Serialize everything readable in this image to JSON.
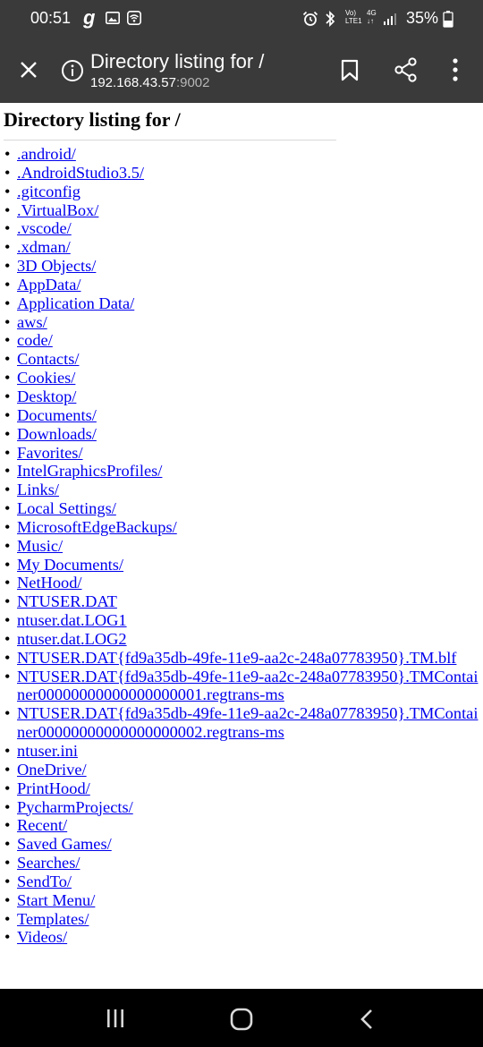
{
  "status_bar": {
    "time": "00:51",
    "carrier_glyph": "g",
    "volte_top": "Vo)",
    "volte_bottom": "LTE1",
    "network_top": "4G",
    "network_bottom": "↓↑",
    "battery": "35%",
    "icons": [
      "image-icon",
      "wifi-calling-icon",
      "alarm-icon",
      "bluetooth-icon",
      "signal-icon",
      "battery-icon"
    ]
  },
  "app_bar": {
    "title": "Directory listing for /",
    "url_host": "192.168.43.57",
    "url_port": ":9002",
    "icons": [
      "close-icon",
      "info-icon",
      "bookmark-icon",
      "share-icon",
      "more-menu-icon"
    ]
  },
  "page": {
    "heading": "Directory listing for /",
    "bullet": "•",
    "entries": [
      ".android/",
      ".AndroidStudio3.5/",
      ".gitconfig",
      ".VirtualBox/",
      ".vscode/",
      ".xdman/",
      "3D Objects/",
      "AppData/",
      "Application Data/",
      "aws/",
      "code/",
      "Contacts/",
      "Cookies/",
      "Desktop/",
      "Documents/",
      "Downloads/",
      "Favorites/",
      "IntelGraphicsProfiles/",
      "Links/",
      "Local Settings/",
      "MicrosoftEdgeBackups/",
      "Music/",
      "My Documents/",
      "NetHood/",
      "NTUSER.DAT",
      "ntuser.dat.LOG1",
      "ntuser.dat.LOG2",
      "NTUSER.DAT{fd9a35db-49fe-11e9-aa2c-248a07783950}.TM.blf",
      "NTUSER.DAT{fd9a35db-49fe-11e9-aa2c-248a07783950}.TMContainer00000000000000000001.regtrans-ms",
      "NTUSER.DAT{fd9a35db-49fe-11e9-aa2c-248a07783950}.TMContainer00000000000000000002.regtrans-ms",
      "ntuser.ini",
      "OneDrive/",
      "PrintHood/",
      "PycharmProjects/",
      "Recent/",
      "Saved Games/",
      "Searches/",
      "SendTo/",
      "Start Menu/",
      "Templates/",
      "Videos/"
    ]
  },
  "nav_bar": {
    "icons": [
      "recents-icon",
      "home-icon",
      "back-icon"
    ]
  }
}
